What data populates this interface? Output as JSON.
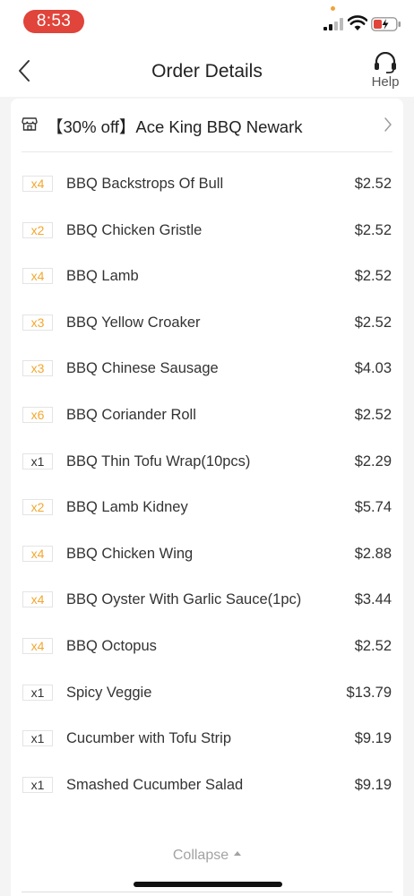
{
  "status_bar": {
    "time": "8:53"
  },
  "header": {
    "title": "Order Details",
    "help_label": "Help"
  },
  "store": {
    "name": "【30% off】Ace King BBQ Newark"
  },
  "items": [
    {
      "qty": "x4",
      "name": "BBQ Backstrops Of Bull",
      "price": "$2.52",
      "highlight": true
    },
    {
      "qty": "x2",
      "name": "BBQ Chicken Gristle",
      "price": "$2.52",
      "highlight": true
    },
    {
      "qty": "x4",
      "name": "BBQ Lamb",
      "price": "$2.52",
      "highlight": true
    },
    {
      "qty": "x3",
      "name": "BBQ Yellow Croaker",
      "price": "$2.52",
      "highlight": true
    },
    {
      "qty": "x3",
      "name": "BBQ Chinese Sausage",
      "price": "$4.03",
      "highlight": true
    },
    {
      "qty": "x6",
      "name": "BBQ Coriander Roll",
      "price": "$2.52",
      "highlight": true
    },
    {
      "qty": "x1",
      "name": "BBQ Thin Tofu Wrap(10pcs)",
      "price": "$2.29",
      "highlight": false
    },
    {
      "qty": "x2",
      "name": "BBQ Lamb Kidney",
      "price": "$5.74",
      "highlight": true
    },
    {
      "qty": "x4",
      "name": "BBQ Chicken Wing",
      "price": "$2.88",
      "highlight": true
    },
    {
      "qty": "x4",
      "name": "BBQ Oyster With Garlic Sauce(1pc)",
      "price": "$3.44",
      "highlight": true
    },
    {
      "qty": "x4",
      "name": "BBQ Octopus",
      "price": "$2.52",
      "highlight": true
    },
    {
      "qty": "x1",
      "name": "Spicy Veggie",
      "price": "$13.79",
      "highlight": false
    },
    {
      "qty": "x1",
      "name": "Cucumber with Tofu Strip",
      "price": "$9.19",
      "highlight": false
    },
    {
      "qty": "x1",
      "name": "Smashed Cucumber Salad",
      "price": "$9.19",
      "highlight": false
    }
  ],
  "collapse_label": "Collapse",
  "colors": {
    "accent": "#f2a72e",
    "time_pill": "#e0443a"
  },
  "icons": [
    "signal-icon",
    "wifi-icon",
    "battery-icon",
    "back-arrow-icon",
    "headset-icon",
    "store-icon",
    "chevron-right-icon",
    "caret-up-icon"
  ]
}
